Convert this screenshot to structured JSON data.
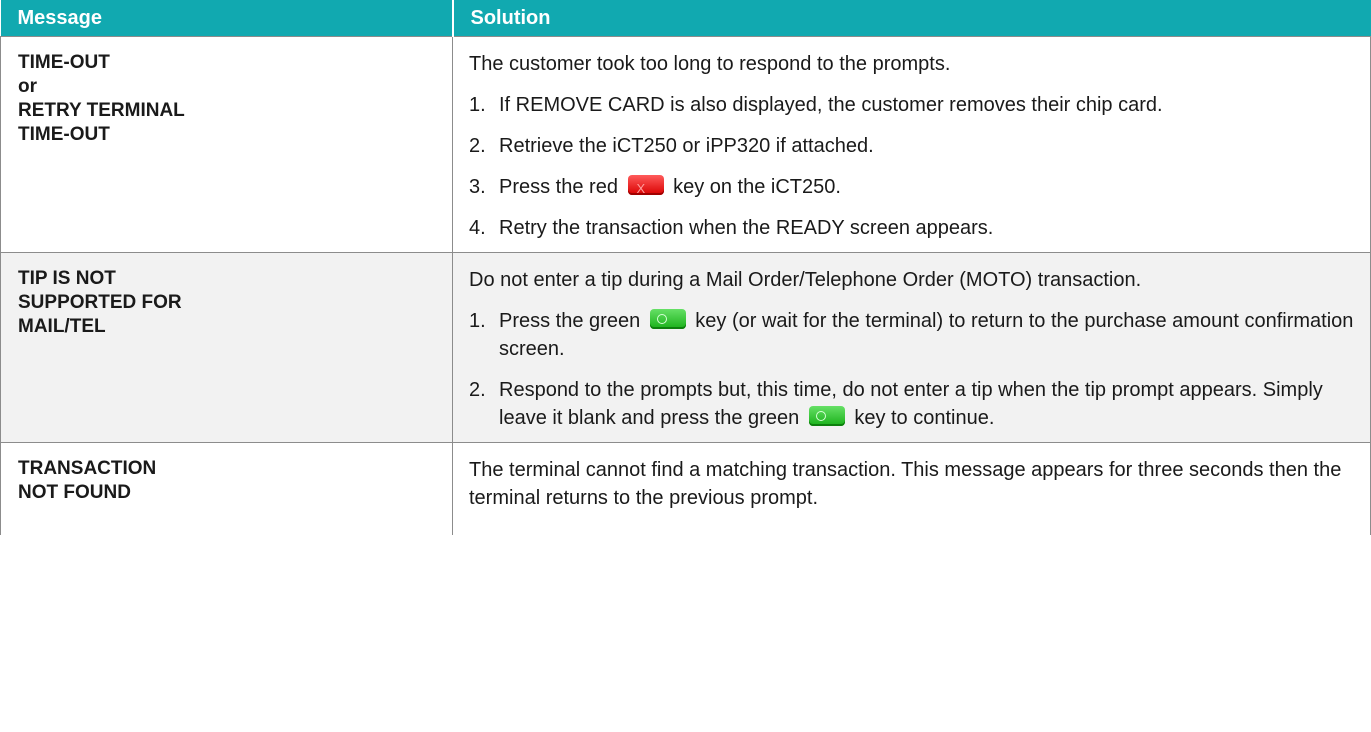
{
  "header": {
    "message": "Message",
    "solution": "Solution"
  },
  "rows": [
    {
      "message_lines": [
        "TIME-OUT",
        "or",
        "RETRY TERMINAL",
        "TIME-OUT"
      ],
      "intro": "The customer took too long to respond to the prompts.",
      "steps": [
        {
          "num": "1.",
          "text": "If REMOVE CARD is also displayed, the customer removes their chip card."
        },
        {
          "num": "2.",
          "text": "Retrieve the iCT250 or iPP320 if attached."
        },
        {
          "num": "3.",
          "before": "Press the red",
          "key": "red-cancel-key-icon",
          "after": "key on the iCT250."
        },
        {
          "num": "4.",
          "text": "Retry the transaction when the READY screen appears."
        }
      ]
    },
    {
      "message_lines": [
        "TIP IS NOT",
        "SUPPORTED FOR",
        "MAIL/TEL"
      ],
      "intro": "Do not enter a tip during a Mail Order/Telephone Order (MOTO) transaction.",
      "steps": [
        {
          "num": "1.",
          "before": "Press the green",
          "key": "green-ok-key-icon",
          "after": "key (or wait for the terminal) to return to the purchase amount confirmation screen."
        },
        {
          "num": "2.",
          "before": "Respond to the prompts but, this time, do not enter a tip when the tip prompt appears. Simply leave it blank and press the green",
          "key": "green-ok-key-icon",
          "after": "key to continue."
        }
      ]
    },
    {
      "message_lines": [
        "TRANSACTION",
        "NOT FOUND"
      ],
      "intro": "The terminal cannot find a matching transaction. This message appears for three seconds then the terminal returns to the previous prompt.",
      "steps": []
    }
  ],
  "colors": {
    "header_bg": "#11a9b0",
    "alt_row_bg": "#f2f2f2",
    "border": "#8c8c8c"
  }
}
